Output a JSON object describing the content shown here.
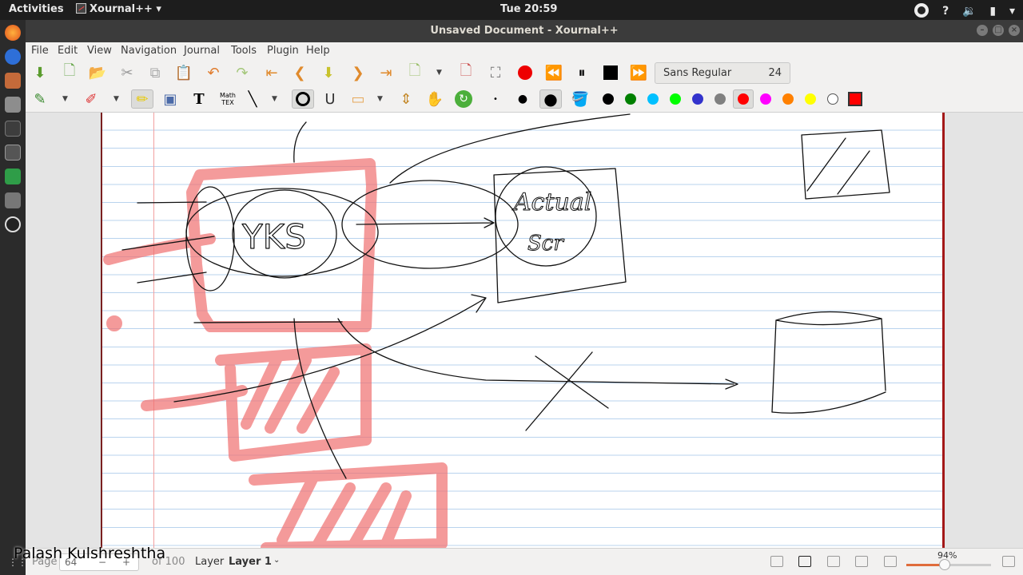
{
  "topbar": {
    "activities": "Activities",
    "app_name": "Xournal++",
    "clock": "Tue 20:59"
  },
  "window": {
    "title": "Unsaved Document - Xournal++"
  },
  "menu": [
    "File",
    "Edit",
    "View",
    "Navigation",
    "Journal",
    "Tools",
    "Plugin",
    "Help"
  ],
  "toolbar": {
    "font_name": "Sans Regular",
    "font_size": "24",
    "math_tex_label": "Math TEX",
    "text_tool_label": "T"
  },
  "colors": {
    "black": "#000000",
    "green": "#008000",
    "light_blue": "#00c0ff",
    "light_green": "#00ff00",
    "blue": "#3333cc",
    "gray": "#808080",
    "red": "#ff0000",
    "magenta": "#ff00ff",
    "orange": "#ff8000",
    "yellow": "#ffff00",
    "white": "#ffffff",
    "highlighter": "#f07070"
  },
  "canvas": {
    "sketch_text_1": "YKS",
    "sketch_text_2": "Actual",
    "sketch_text_3": "Scr"
  },
  "statusbar": {
    "page_label": "Page",
    "page_number": "64",
    "page_of": "of 100",
    "layer_label": "Layer",
    "layer_value": "Layer 1",
    "zoom": "94%",
    "zoom_fraction": 0.45
  },
  "overlay": {
    "author": "Palash Kulshreshtha"
  }
}
